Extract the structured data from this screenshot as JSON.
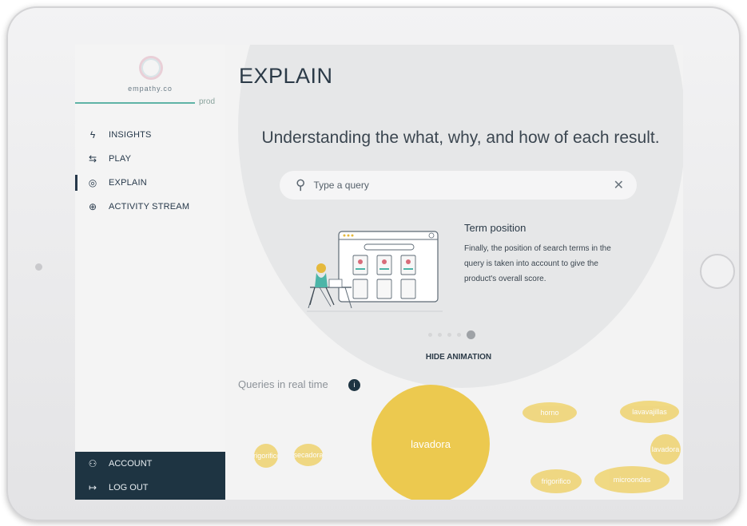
{
  "app": {
    "brand": "empathy.co",
    "environment": "prod"
  },
  "sidebar": {
    "items": [
      {
        "label": "INSIGHTS",
        "icon": "bolt-icon",
        "glyph": "ϟ"
      },
      {
        "label": "PLAY",
        "icon": "sliders-icon",
        "glyph": "⇆"
      },
      {
        "label": "EXPLAIN",
        "icon": "eye-icon",
        "glyph": "◎"
      },
      {
        "label": "ACTIVITY STREAM",
        "icon": "search-zoom-icon",
        "glyph": "⊕"
      }
    ],
    "account": [
      {
        "label": "ACCOUNT",
        "icon": "users-icon",
        "glyph": "⚇"
      },
      {
        "label": "LOG OUT",
        "icon": "logout-icon",
        "glyph": "↦"
      }
    ]
  },
  "main": {
    "title": "EXPLAIN",
    "headline": "Understanding the what, why, and how of each result.",
    "search": {
      "placeholder": "Type a query",
      "value": ""
    },
    "term": {
      "title": "Term position",
      "text": "Finally, the position of search terms in the query is taken into account to give the product's overall score."
    },
    "carousel": {
      "count": 5,
      "active_index": 4
    },
    "hide_animation": "HIDE ANIMATION",
    "queries_title": "Queries in real time",
    "queries_info": "i",
    "bubbles": [
      {
        "label": "lavadora"
      },
      {
        "label": "frigorifico"
      },
      {
        "label": "secadora"
      },
      {
        "label": "horno"
      },
      {
        "label": "lavavajillas"
      },
      {
        "label": "lavadora"
      },
      {
        "label": "frigorifico"
      },
      {
        "label": "microondas"
      }
    ]
  },
  "colors": {
    "accent": "#1e3442",
    "bubble": "#ecc94f",
    "env_line": "#5fb3a6"
  }
}
